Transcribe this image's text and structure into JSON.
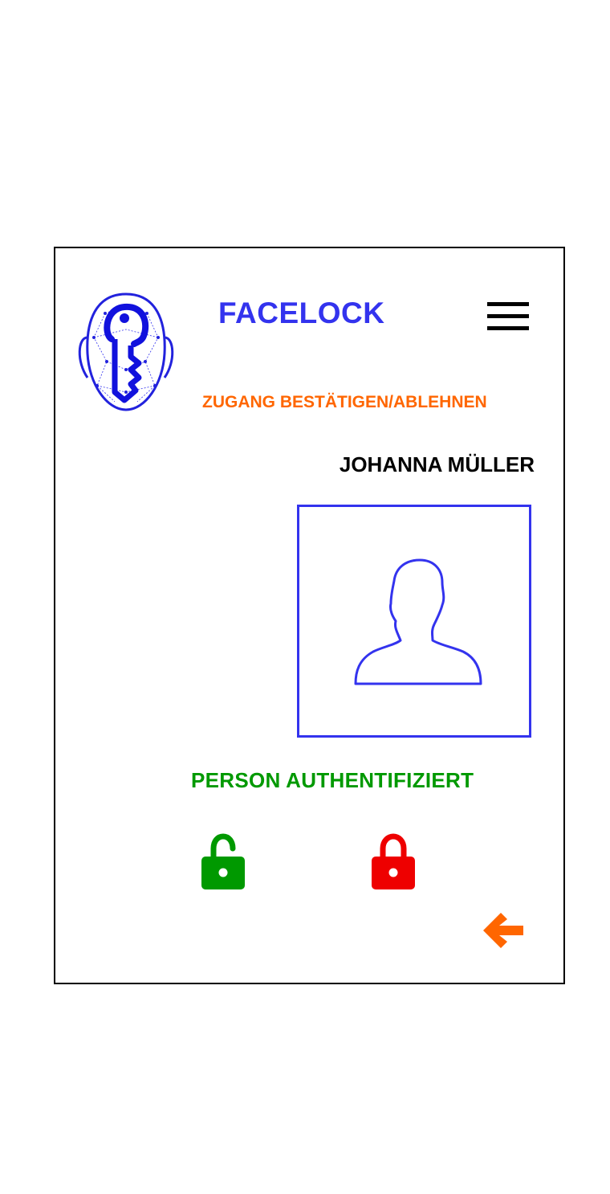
{
  "app": {
    "title": "FACELOCK",
    "logo_icon": "face-key-logo-icon",
    "menu_icon": "hamburger-menu-icon"
  },
  "screen": {
    "subtitle": "ZUGANG BESTÄTIGEN/ABLEHNEN",
    "person_name": "JOHANNA MÜLLER",
    "photo_icon": "user-silhouette-icon",
    "status": "PERSON AUTHENTIFIZIERT"
  },
  "actions": {
    "confirm_icon": "unlocked-padlock-icon",
    "reject_icon": "locked-padlock-icon",
    "back_icon": "back-arrow-icon"
  },
  "colors": {
    "brand": "#3333ee",
    "accent": "#ff6600",
    "success": "#009900",
    "danger": "#ee0000",
    "frame": "#000000"
  }
}
